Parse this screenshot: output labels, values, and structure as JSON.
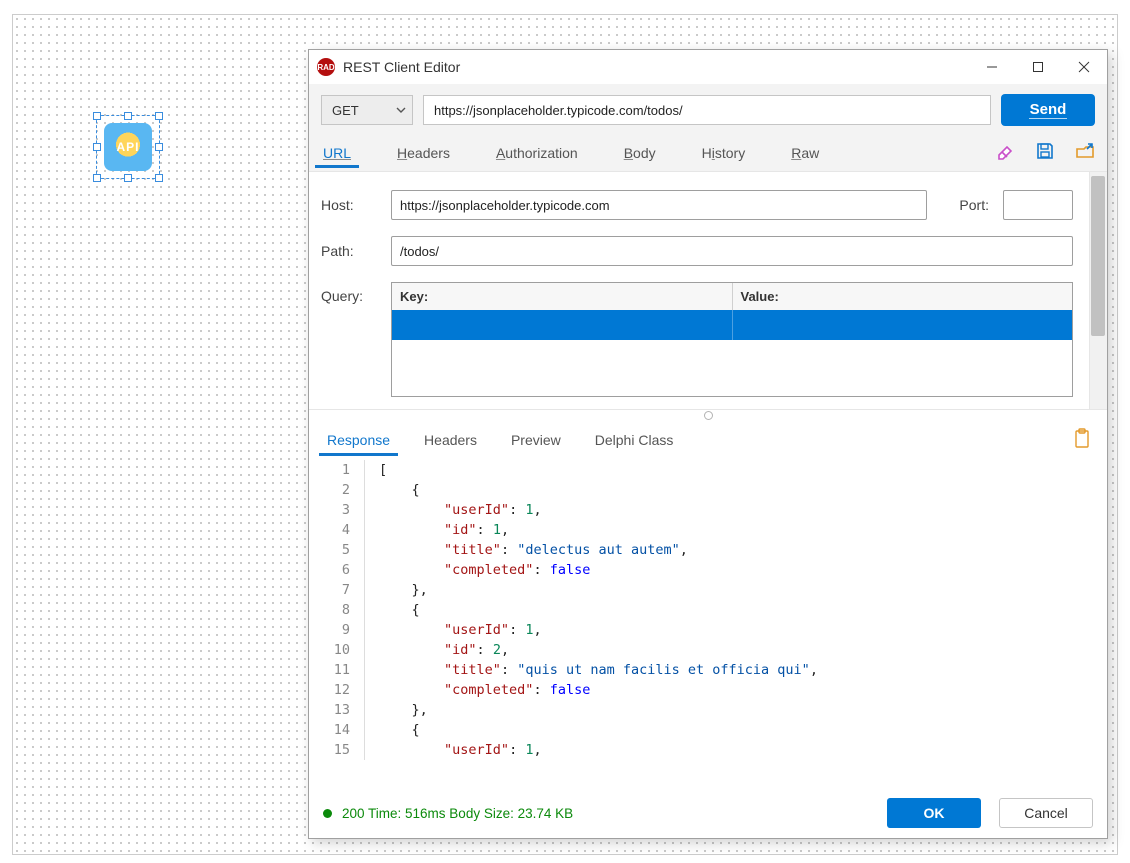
{
  "window": {
    "title": "REST Client Editor"
  },
  "request_row": {
    "method": "GET",
    "url": "https://jsonplaceholder.typicode.com/todos/",
    "send_label": "Send"
  },
  "tabs": {
    "url": "URL",
    "headers": "Headers",
    "authorization": "Authorization",
    "body": "Body",
    "history": "History",
    "raw": "Raw"
  },
  "url_form": {
    "host_label": "Host:",
    "host_value": "https://jsonplaceholder.typicode.com",
    "port_label": "Port:",
    "port_value": "",
    "path_label": "Path:",
    "path_value": "/todos/",
    "query_label": "Query:",
    "query_key_header": "Key:",
    "query_value_header": "Value:"
  },
  "response_tabs": {
    "response": "Response",
    "headers": "Headers",
    "preview": "Preview",
    "delphi_class": "Delphi Class"
  },
  "response_code": [
    {
      "n": 1,
      "segs": [
        [
          "[",
          "p"
        ]
      ]
    },
    {
      "n": 2,
      "segs": [
        [
          "    {",
          "p"
        ]
      ]
    },
    {
      "n": 3,
      "segs": [
        [
          "        ",
          "p"
        ],
        [
          "\"userId\"",
          "k"
        ],
        [
          ": ",
          "p"
        ],
        [
          "1",
          "n"
        ],
        [
          ",",
          "p"
        ]
      ]
    },
    {
      "n": 4,
      "segs": [
        [
          "        ",
          "p"
        ],
        [
          "\"id\"",
          "k"
        ],
        [
          ": ",
          "p"
        ],
        [
          "1",
          "n"
        ],
        [
          ",",
          "p"
        ]
      ]
    },
    {
      "n": 5,
      "segs": [
        [
          "        ",
          "p"
        ],
        [
          "\"title\"",
          "k"
        ],
        [
          ": ",
          "p"
        ],
        [
          "\"delectus aut autem\"",
          "s"
        ],
        [
          ",",
          "p"
        ]
      ]
    },
    {
      "n": 6,
      "segs": [
        [
          "        ",
          "p"
        ],
        [
          "\"completed\"",
          "k"
        ],
        [
          ": ",
          "p"
        ],
        [
          "false",
          "kw"
        ]
      ]
    },
    {
      "n": 7,
      "segs": [
        [
          "    },",
          "p"
        ]
      ]
    },
    {
      "n": 8,
      "segs": [
        [
          "    {",
          "p"
        ]
      ]
    },
    {
      "n": 9,
      "segs": [
        [
          "        ",
          "p"
        ],
        [
          "\"userId\"",
          "k"
        ],
        [
          ": ",
          "p"
        ],
        [
          "1",
          "n"
        ],
        [
          ",",
          "p"
        ]
      ]
    },
    {
      "n": 10,
      "segs": [
        [
          "        ",
          "p"
        ],
        [
          "\"id\"",
          "k"
        ],
        [
          ": ",
          "p"
        ],
        [
          "2",
          "n"
        ],
        [
          ",",
          "p"
        ]
      ]
    },
    {
      "n": 11,
      "segs": [
        [
          "        ",
          "p"
        ],
        [
          "\"title\"",
          "k"
        ],
        [
          ": ",
          "p"
        ],
        [
          "\"quis ut nam facilis et officia qui\"",
          "s"
        ],
        [
          ",",
          "p"
        ]
      ]
    },
    {
      "n": 12,
      "segs": [
        [
          "        ",
          "p"
        ],
        [
          "\"completed\"",
          "k"
        ],
        [
          ": ",
          "p"
        ],
        [
          "false",
          "kw"
        ]
      ]
    },
    {
      "n": 13,
      "segs": [
        [
          "    },",
          "p"
        ]
      ]
    },
    {
      "n": 14,
      "segs": [
        [
          "    {",
          "p"
        ]
      ]
    },
    {
      "n": 15,
      "segs": [
        [
          "        ",
          "p"
        ],
        [
          "\"userId\"",
          "k"
        ],
        [
          ": ",
          "p"
        ],
        [
          "1",
          "n"
        ],
        [
          ",",
          "p"
        ]
      ]
    }
  ],
  "status": {
    "text": "200 Time: 516ms Body Size: 23.74 KB",
    "ok_label": "OK",
    "cancel_label": "Cancel"
  },
  "designer": {
    "component_text": "API"
  }
}
